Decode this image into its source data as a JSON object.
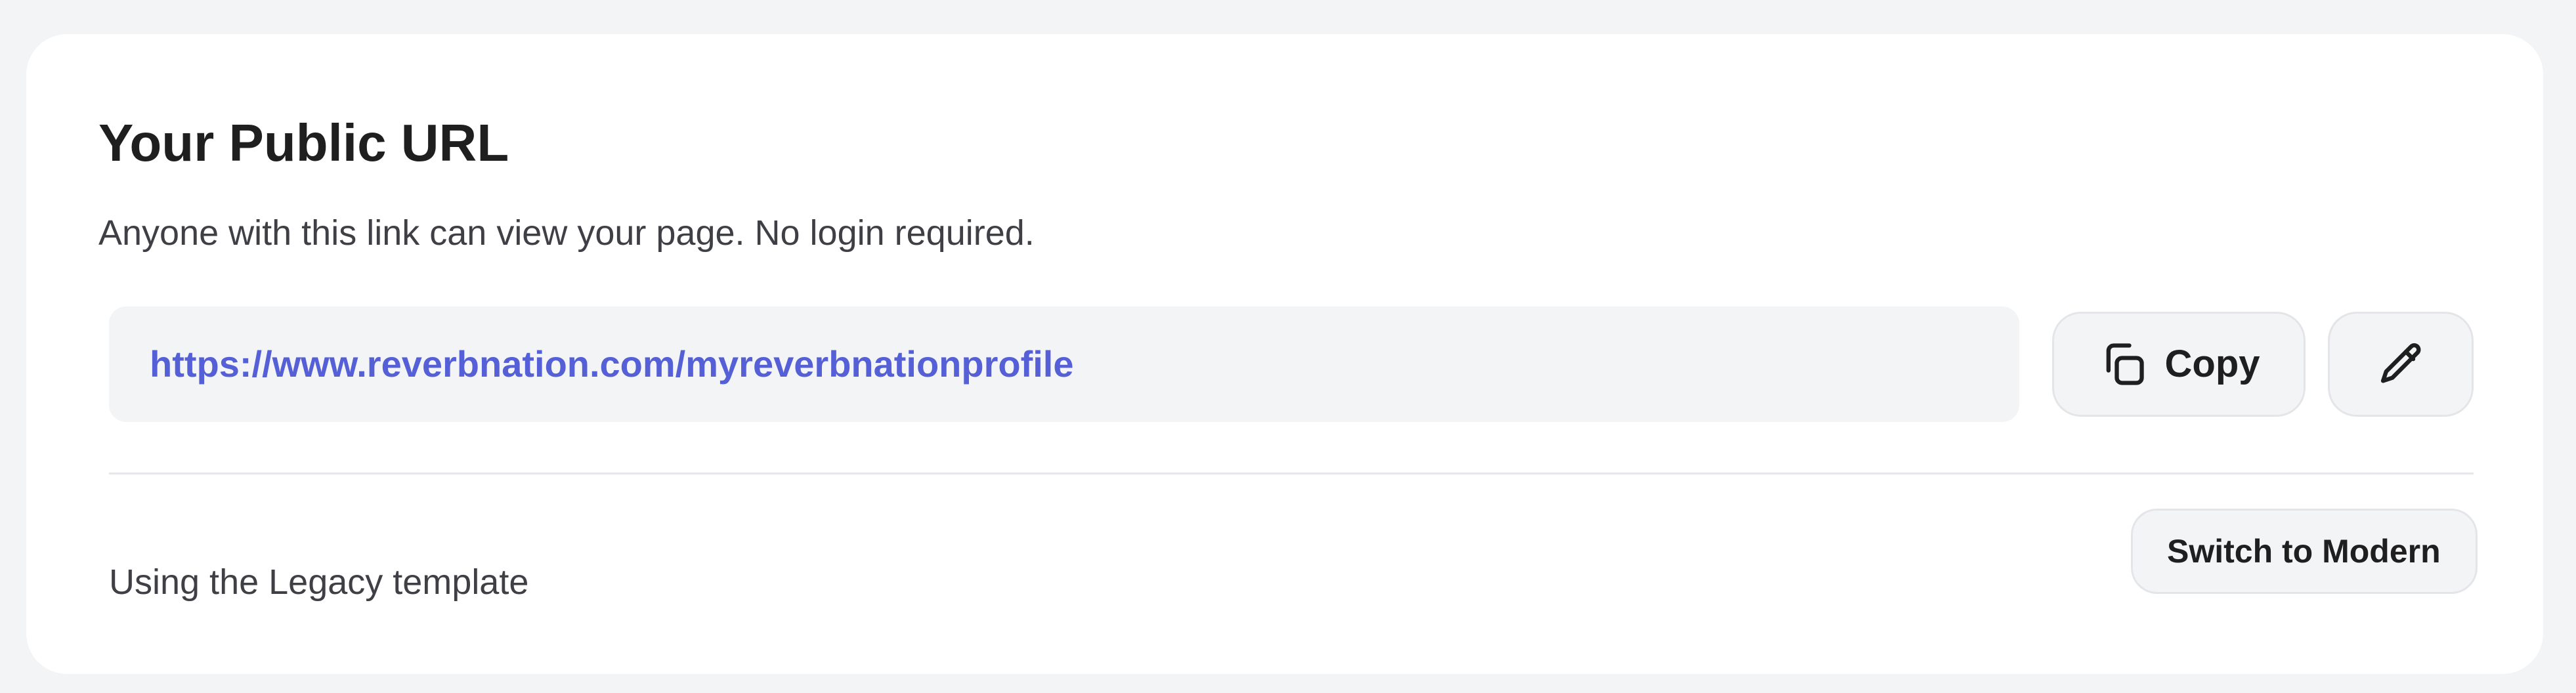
{
  "header": {
    "title": "Your Public URL",
    "subtitle": "Anyone with this link can view your page. No login required."
  },
  "url": {
    "value": "https://www.reverbnation.com/myreverbnationprofile"
  },
  "actions": {
    "copy_label": "Copy",
    "copy_icon": "copy-icon",
    "edit_icon": "pencil-icon"
  },
  "template": {
    "status_text": "Using the Legacy template",
    "switch_label": "Switch to Modern"
  },
  "colors": {
    "page_background": "#f3f4f6",
    "card_background": "#ffffff",
    "url_accent": "#5560d6"
  }
}
